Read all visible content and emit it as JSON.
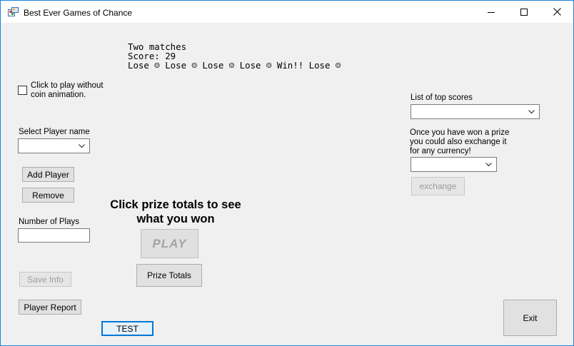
{
  "window": {
    "title": "Best Ever Games of Chance",
    "controls": {
      "minimize": "minimize-icon",
      "maximize": "maximize-icon",
      "close": "close-icon"
    }
  },
  "results": {
    "line1": "Two matches",
    "line2": "Score: 29",
    "line3": "Lose ☺ Lose ☺ Lose ☺ Lose ☺ Win!! Lose ☺"
  },
  "options": {
    "no_animation_label": "Click to play without coin animation.",
    "no_animation_checked": false
  },
  "player": {
    "select_label": "Select Player name",
    "selected_value": "",
    "add_button": "Add Player",
    "remove_button": "Remove",
    "plays_label": "Number of Plays",
    "plays_value": "",
    "save_button": "Save Info",
    "report_button": "Player Report"
  },
  "game": {
    "prize_heading": "Click prize totals to see what you won",
    "play_button": "PLAY",
    "prize_totals_button": "Prize Totals",
    "test_button": "TEST"
  },
  "scores": {
    "top_scores_label": "List of top scores",
    "top_scores_value": "",
    "exchange_label": "Once you have won a prize you could also exchange it for any currency!",
    "currency_value": "",
    "exchange_button": "exchange",
    "exit_button": "Exit"
  }
}
